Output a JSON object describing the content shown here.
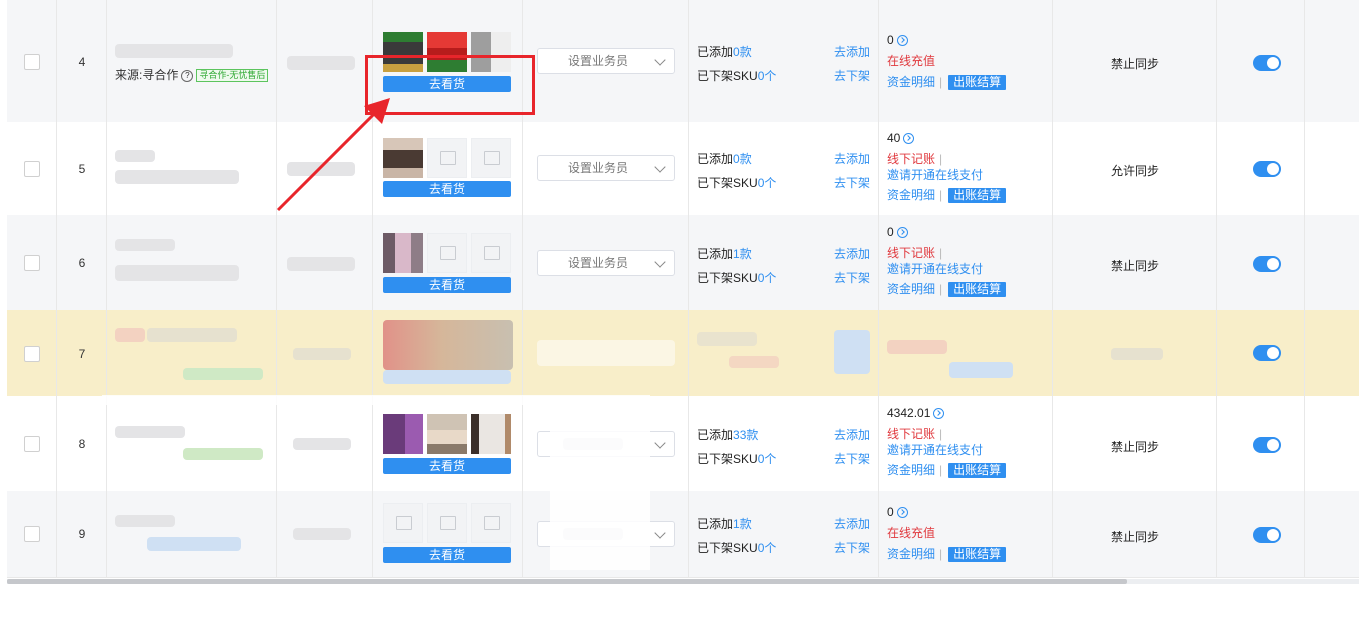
{
  "rows": [
    {
      "index": "4",
      "source_label": "来源:寻合作",
      "source_tag": "寻合作-无忧售后",
      "see_button": "去看货",
      "select_placeholder": "设置业务员",
      "added_label": "已添加",
      "added_count": "0款",
      "delisted_label": "已下架SKU",
      "delisted_count": "0个",
      "go_add": "去添加",
      "go_delist": "去下架",
      "amount": "0",
      "status": "在线充值",
      "funds": "资金明细",
      "settle": "出账结算",
      "sync": "禁止同步"
    },
    {
      "index": "5",
      "see_button": "去看货",
      "select_placeholder": "设置业务员",
      "added_label": "已添加",
      "added_count": "0款",
      "delisted_label": "已下架SKU",
      "delisted_count": "0个",
      "go_add": "去添加",
      "go_delist": "去下架",
      "amount": "40",
      "status": "线下记账",
      "invite": "邀请开通在线支付",
      "funds": "资金明细",
      "settle": "出账结算",
      "sync": "允许同步"
    },
    {
      "index": "6",
      "see_button": "去看货",
      "select_placeholder": "设置业务员",
      "added_label": "已添加",
      "added_count": "1款",
      "delisted_label": "已下架SKU",
      "delisted_count": "0个",
      "go_add": "去添加",
      "go_delist": "去下架",
      "amount": "0",
      "status": "线下记账",
      "invite": "邀请开通在线支付",
      "funds": "资金明细",
      "settle": "出账结算",
      "sync": "禁止同步"
    },
    {
      "index": "7"
    },
    {
      "index": "8",
      "see_button": "去看货",
      "added_label": "已添加",
      "added_count": "33款",
      "delisted_label": "已下架SKU",
      "delisted_count": "0个",
      "go_add": "去添加",
      "go_delist": "去下架",
      "amount": "4342.01",
      "status": "线下记账",
      "invite": "邀请开通在线支付",
      "funds": "资金明细",
      "settle": "出账结算",
      "sync": "禁止同步"
    },
    {
      "index": "9",
      "see_button": "去看货",
      "added_label": "已添加",
      "added_count": "1款",
      "delisted_label": "已下架SKU",
      "delisted_count": "0个",
      "go_add": "去添加",
      "go_delist": "去下架",
      "amount": "0",
      "status": "在线充值",
      "funds": "资金明细",
      "settle": "出账结算",
      "sync": "禁止同步"
    }
  ],
  "colors": {
    "accent": "#2f8ff0",
    "danger": "#e0393e",
    "highlight_row": "#f8eec9",
    "annotation": "#e8252b"
  }
}
